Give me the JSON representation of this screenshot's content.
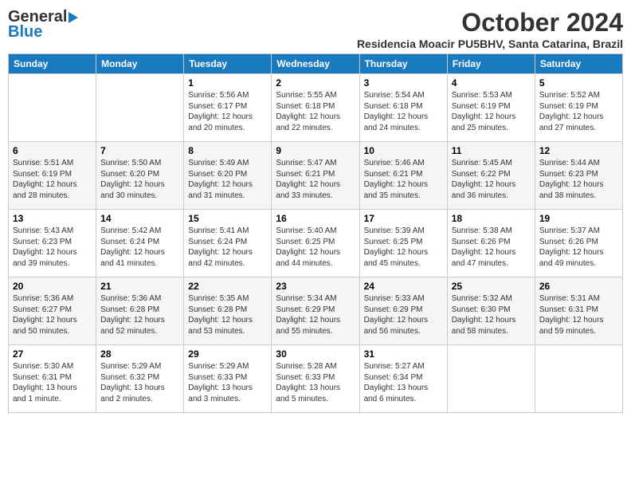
{
  "header": {
    "logo_general": "General",
    "logo_blue": "Blue",
    "month_title": "October 2024",
    "subtitle": "Residencia Moacir PU5BHV, Santa Catarina, Brazil"
  },
  "days_of_week": [
    "Sunday",
    "Monday",
    "Tuesday",
    "Wednesday",
    "Thursday",
    "Friday",
    "Saturday"
  ],
  "weeks": [
    [
      {
        "day": "",
        "info": ""
      },
      {
        "day": "",
        "info": ""
      },
      {
        "day": "1",
        "info": "Sunrise: 5:56 AM\nSunset: 6:17 PM\nDaylight: 12 hours\nand 20 minutes."
      },
      {
        "day": "2",
        "info": "Sunrise: 5:55 AM\nSunset: 6:18 PM\nDaylight: 12 hours\nand 22 minutes."
      },
      {
        "day": "3",
        "info": "Sunrise: 5:54 AM\nSunset: 6:18 PM\nDaylight: 12 hours\nand 24 minutes."
      },
      {
        "day": "4",
        "info": "Sunrise: 5:53 AM\nSunset: 6:19 PM\nDaylight: 12 hours\nand 25 minutes."
      },
      {
        "day": "5",
        "info": "Sunrise: 5:52 AM\nSunset: 6:19 PM\nDaylight: 12 hours\nand 27 minutes."
      }
    ],
    [
      {
        "day": "6",
        "info": "Sunrise: 5:51 AM\nSunset: 6:19 PM\nDaylight: 12 hours\nand 28 minutes."
      },
      {
        "day": "7",
        "info": "Sunrise: 5:50 AM\nSunset: 6:20 PM\nDaylight: 12 hours\nand 30 minutes."
      },
      {
        "day": "8",
        "info": "Sunrise: 5:49 AM\nSunset: 6:20 PM\nDaylight: 12 hours\nand 31 minutes."
      },
      {
        "day": "9",
        "info": "Sunrise: 5:47 AM\nSunset: 6:21 PM\nDaylight: 12 hours\nand 33 minutes."
      },
      {
        "day": "10",
        "info": "Sunrise: 5:46 AM\nSunset: 6:21 PM\nDaylight: 12 hours\nand 35 minutes."
      },
      {
        "day": "11",
        "info": "Sunrise: 5:45 AM\nSunset: 6:22 PM\nDaylight: 12 hours\nand 36 minutes."
      },
      {
        "day": "12",
        "info": "Sunrise: 5:44 AM\nSunset: 6:23 PM\nDaylight: 12 hours\nand 38 minutes."
      }
    ],
    [
      {
        "day": "13",
        "info": "Sunrise: 5:43 AM\nSunset: 6:23 PM\nDaylight: 12 hours\nand 39 minutes."
      },
      {
        "day": "14",
        "info": "Sunrise: 5:42 AM\nSunset: 6:24 PM\nDaylight: 12 hours\nand 41 minutes."
      },
      {
        "day": "15",
        "info": "Sunrise: 5:41 AM\nSunset: 6:24 PM\nDaylight: 12 hours\nand 42 minutes."
      },
      {
        "day": "16",
        "info": "Sunrise: 5:40 AM\nSunset: 6:25 PM\nDaylight: 12 hours\nand 44 minutes."
      },
      {
        "day": "17",
        "info": "Sunrise: 5:39 AM\nSunset: 6:25 PM\nDaylight: 12 hours\nand 45 minutes."
      },
      {
        "day": "18",
        "info": "Sunrise: 5:38 AM\nSunset: 6:26 PM\nDaylight: 12 hours\nand 47 minutes."
      },
      {
        "day": "19",
        "info": "Sunrise: 5:37 AM\nSunset: 6:26 PM\nDaylight: 12 hours\nand 49 minutes."
      }
    ],
    [
      {
        "day": "20",
        "info": "Sunrise: 5:36 AM\nSunset: 6:27 PM\nDaylight: 12 hours\nand 50 minutes."
      },
      {
        "day": "21",
        "info": "Sunrise: 5:36 AM\nSunset: 6:28 PM\nDaylight: 12 hours\nand 52 minutes."
      },
      {
        "day": "22",
        "info": "Sunrise: 5:35 AM\nSunset: 6:28 PM\nDaylight: 12 hours\nand 53 minutes."
      },
      {
        "day": "23",
        "info": "Sunrise: 5:34 AM\nSunset: 6:29 PM\nDaylight: 12 hours\nand 55 minutes."
      },
      {
        "day": "24",
        "info": "Sunrise: 5:33 AM\nSunset: 6:29 PM\nDaylight: 12 hours\nand 56 minutes."
      },
      {
        "day": "25",
        "info": "Sunrise: 5:32 AM\nSunset: 6:30 PM\nDaylight: 12 hours\nand 58 minutes."
      },
      {
        "day": "26",
        "info": "Sunrise: 5:31 AM\nSunset: 6:31 PM\nDaylight: 12 hours\nand 59 minutes."
      }
    ],
    [
      {
        "day": "27",
        "info": "Sunrise: 5:30 AM\nSunset: 6:31 PM\nDaylight: 13 hours\nand 1 minute."
      },
      {
        "day": "28",
        "info": "Sunrise: 5:29 AM\nSunset: 6:32 PM\nDaylight: 13 hours\nand 2 minutes."
      },
      {
        "day": "29",
        "info": "Sunrise: 5:29 AM\nSunset: 6:33 PM\nDaylight: 13 hours\nand 3 minutes."
      },
      {
        "day": "30",
        "info": "Sunrise: 5:28 AM\nSunset: 6:33 PM\nDaylight: 13 hours\nand 5 minutes."
      },
      {
        "day": "31",
        "info": "Sunrise: 5:27 AM\nSunset: 6:34 PM\nDaylight: 13 hours\nand 6 minutes."
      },
      {
        "day": "",
        "info": ""
      },
      {
        "day": "",
        "info": ""
      }
    ]
  ]
}
